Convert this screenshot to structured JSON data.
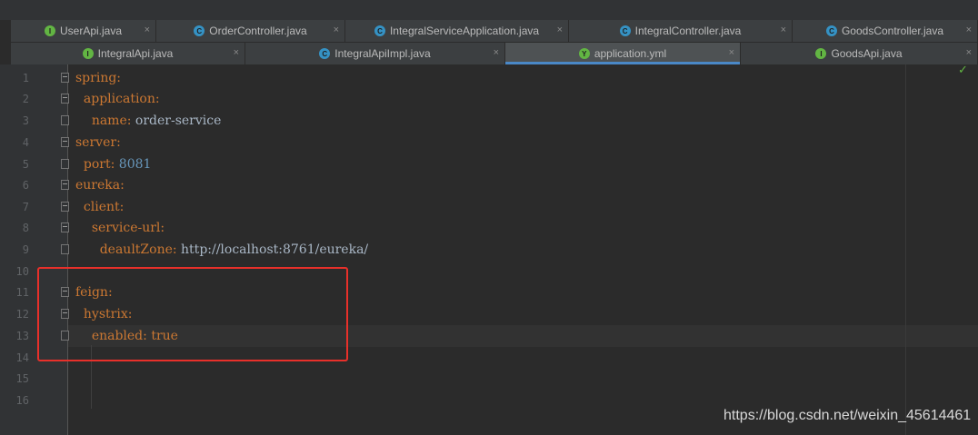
{
  "tabs_row1": [
    {
      "label": "UserApi.java",
      "icon": "I",
      "kind": "interface"
    },
    {
      "label": "OrderController.java",
      "icon": "C",
      "kind": "class"
    },
    {
      "label": "IntegralServiceApplication.java",
      "icon": "C",
      "kind": "class"
    },
    {
      "label": "IntegralController.java",
      "icon": "C",
      "kind": "class"
    },
    {
      "label": "GoodsController.java",
      "icon": "C",
      "kind": "class"
    }
  ],
  "tabs_row2": [
    {
      "label": "IntegralApi.java",
      "icon": "I",
      "kind": "interface"
    },
    {
      "label": "IntegralApiImpl.java",
      "icon": "C",
      "kind": "class"
    },
    {
      "label": "application.yml",
      "icon": "Y",
      "kind": "yaml",
      "active": true
    },
    {
      "label": "GoodsApi.java",
      "icon": "I",
      "kind": "interface"
    }
  ],
  "close_glyph": "×",
  "inspection_status": "✓",
  "lines": [
    {
      "n": "1",
      "key": "spring",
      "sep": ":",
      "value": ""
    },
    {
      "n": "2",
      "key": "application",
      "sep": ":",
      "value": ""
    },
    {
      "n": "3",
      "key": "name",
      "sep": ":",
      "value": " order-service"
    },
    {
      "n": "4",
      "key": "server",
      "sep": ":",
      "value": ""
    },
    {
      "n": "5",
      "key": "port",
      "sep": ":",
      "value": " 8081"
    },
    {
      "n": "6",
      "key": "eureka",
      "sep": ":",
      "value": ""
    },
    {
      "n": "7",
      "key": "client",
      "sep": ":",
      "value": ""
    },
    {
      "n": "8",
      "key": "service-url",
      "sep": ":",
      "value": ""
    },
    {
      "n": "9",
      "key": "deaultZone",
      "sep": ":",
      "value": " http://localhost:8761/eureka/"
    },
    {
      "n": "10",
      "key": "",
      "sep": "",
      "value": ""
    },
    {
      "n": "11",
      "key": "feign",
      "sep": ":",
      "value": ""
    },
    {
      "n": "12",
      "key": "hystrix",
      "sep": ":",
      "value": ""
    },
    {
      "n": "13",
      "key": "enabled",
      "sep": ":",
      "value": " true"
    },
    {
      "n": "14",
      "key": "",
      "sep": "",
      "value": ""
    },
    {
      "n": "15",
      "key": "",
      "sep": "",
      "value": ""
    },
    {
      "n": "16",
      "key": "",
      "sep": "",
      "value": ""
    }
  ],
  "watermark": "https://blog.csdn.net/weixin_45614461",
  "colors": {
    "key": "#cc7832",
    "number": "#6897bb",
    "text": "#a9b7c6",
    "highlight_box": "#e8302a",
    "active_tab_underline": "#4a88c7"
  }
}
